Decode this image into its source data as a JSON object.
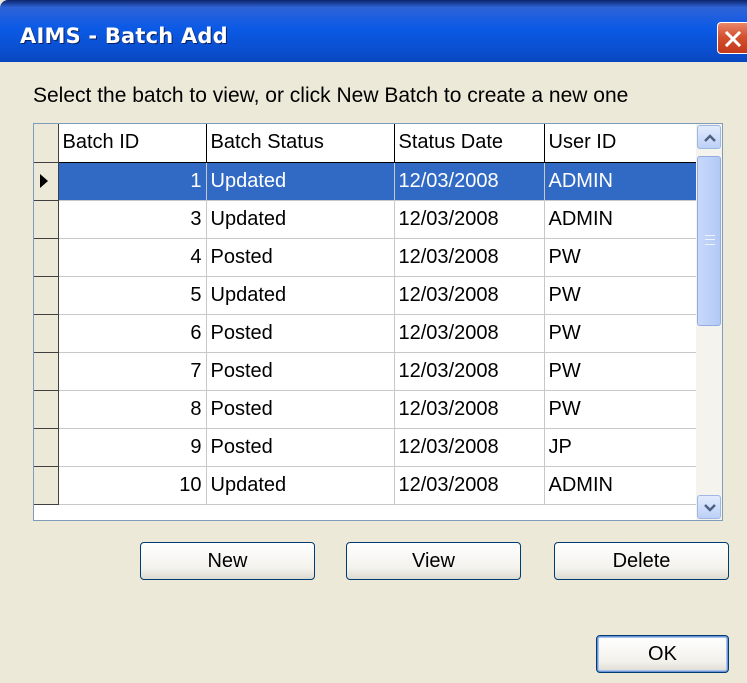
{
  "window": {
    "title": "AIMS - Batch Add"
  },
  "instruction": "Select the batch to view, or click New Batch to create a new one",
  "grid": {
    "columns": [
      "Batch ID",
      "Batch Status",
      "Status Date",
      "User ID"
    ],
    "selected_index": 0,
    "rows": [
      {
        "id": "1",
        "status": "Updated",
        "date": "12/03/2008",
        "user": "ADMIN"
      },
      {
        "id": "3",
        "status": "Updated",
        "date": "12/03/2008",
        "user": "ADMIN"
      },
      {
        "id": "4",
        "status": "Posted",
        "date": "12/03/2008",
        "user": "PW"
      },
      {
        "id": "5",
        "status": "Updated",
        "date": "12/03/2008",
        "user": "PW"
      },
      {
        "id": "6",
        "status": "Posted",
        "date": "12/03/2008",
        "user": "PW"
      },
      {
        "id": "7",
        "status": "Posted",
        "date": "12/03/2008",
        "user": "PW"
      },
      {
        "id": "8",
        "status": "Posted",
        "date": "12/03/2008",
        "user": "PW"
      },
      {
        "id": "9",
        "status": "Posted",
        "date": "12/03/2008",
        "user": "JP"
      },
      {
        "id": "10",
        "status": "Updated",
        "date": "12/03/2008",
        "user": "ADMIN"
      }
    ]
  },
  "buttons": {
    "new": "New",
    "view": "View",
    "delete": "Delete",
    "ok": "OK"
  },
  "icons": {
    "close": "close-icon",
    "row_pointer": "row-pointer-icon",
    "scroll_up": "chevron-up-icon",
    "scroll_down": "chevron-down-icon"
  },
  "colors": {
    "selection": "#316ac5",
    "titlebar": "#0b5ae6",
    "dialog_bg": "#ece9d8",
    "close_button": "#d4512f"
  }
}
